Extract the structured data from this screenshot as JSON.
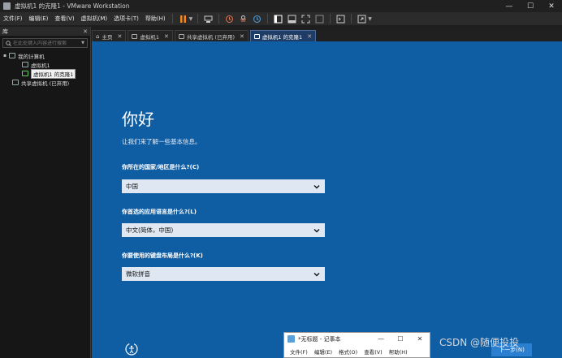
{
  "window": {
    "title": "虚拟机1 的克隆1 - VMware Workstation",
    "controls": [
      "—",
      "☐",
      "✕"
    ]
  },
  "menu": [
    "文件(F)",
    "编辑(E)",
    "查看(V)",
    "虚拟机(M)",
    "选项卡(T)",
    "帮助(H)"
  ],
  "library": {
    "header": "库",
    "close": "✕",
    "search_placeholder": "在此处键入内容进行搜索",
    "tree": {
      "root": "我的计算机",
      "vm1": "虚拟机1",
      "vm1_clone": "虚拟机1 的克隆1",
      "shared": "共享虚拟机 (已弃用)"
    }
  },
  "tabs": [
    {
      "label": "主页",
      "active": false
    },
    {
      "label": "虚拟机1",
      "active": false
    },
    {
      "label": "共享虚拟机 (已弃用)",
      "active": false
    },
    {
      "label": "虚拟机1 的克隆1",
      "active": true
    }
  ],
  "oobe": {
    "title": "你好",
    "subtitle": "让我们来了解一些基本信息。",
    "q_region": "你所在的国家/地区是什么?(C)",
    "region_value": "中国",
    "q_language": "你首选的应用语言是什么?(L)",
    "language_value": "中文(简体，中国)",
    "q_keyboard": "你要使用的键盘布局是什么?(K)",
    "keyboard_value": "微软拼音",
    "next": "下一步(N)"
  },
  "notepad": {
    "title": "*无标题 - 记事本",
    "menu": [
      "文件(F)",
      "编辑(E)",
      "格式(O)",
      "查看(V)",
      "帮助(H)"
    ]
  },
  "watermark": "CSDN @随便投投",
  "colors": {
    "vm_background": "#0f5da3",
    "pause_orange": "#f08a24",
    "active_tab": "#1f3c66"
  }
}
